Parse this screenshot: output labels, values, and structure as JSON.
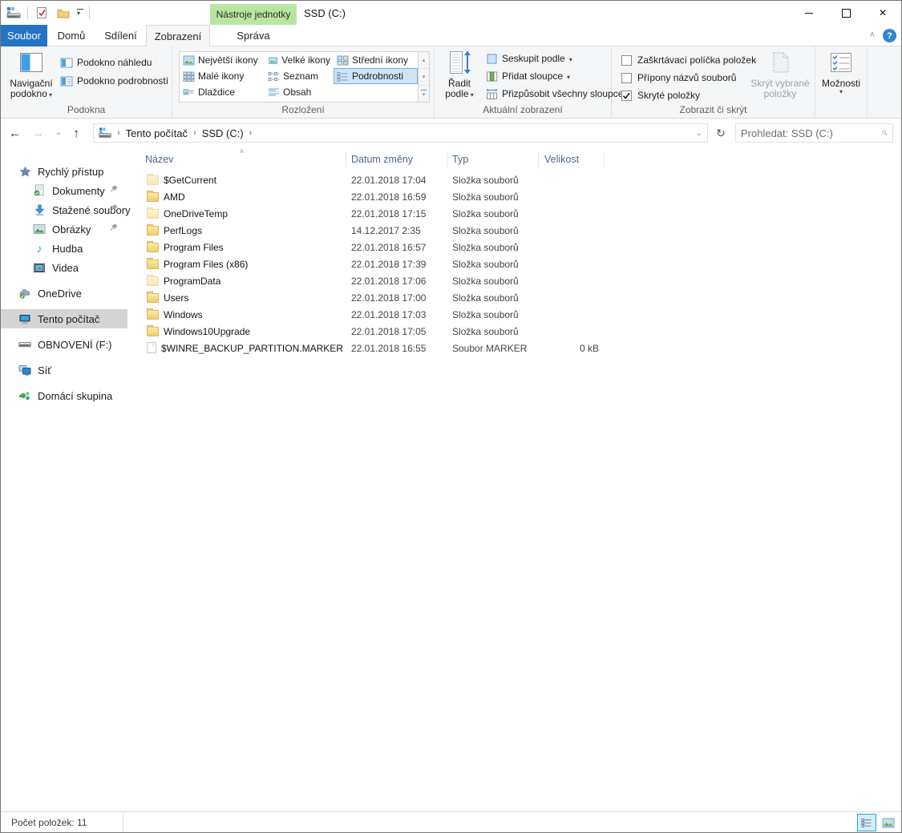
{
  "window": {
    "title": "SSD (C:)",
    "contextual_group": "Nástroje jednotky"
  },
  "tabs": {
    "file": "Soubor",
    "home": "Domů",
    "share": "Sdílení",
    "view": "Zobrazení",
    "manage": "Správa"
  },
  "ribbon": {
    "panes": {
      "label": "Podokna",
      "nav_l1": "Navigační",
      "nav_l2": "podokno",
      "preview": "Podokno náhledu",
      "details": "Podokno podrobností"
    },
    "layout": {
      "label": "Rozložení",
      "items": [
        "Největší ikony",
        "Velké ikony",
        "Střední ikony",
        "Malé ikony",
        "Seznam",
        "Podrobnosti",
        "Dlaždice",
        "Obsah"
      ],
      "selected": "Podrobnosti"
    },
    "view": {
      "label": "Aktuální zobrazení",
      "sort_l1": "Řadit",
      "sort_l2": "podle",
      "group_by": "Seskupit podle",
      "add_columns": "Přidat sloupce",
      "fit_columns": "Přizpůsobit všechny sloupce"
    },
    "showhide": {
      "label": "Zobrazit či skrýt",
      "cb_item_checkboxes": "Zaškrtávací políčka položek",
      "cb_extensions": "Přípony názvů souborů",
      "cb_hidden": "Skryté položky",
      "cb_hidden_checked": true,
      "hide_l1": "Skrýt vybrané",
      "hide_l2": "položky"
    },
    "options": {
      "label": "Možnosti"
    }
  },
  "address": {
    "crumb_root": "Tento počítač",
    "crumb_drive": "SSD (C:)",
    "search_placeholder": "Prohledat: SSD (C:)"
  },
  "sidebar": {
    "quick_access": "Rychlý přístup",
    "documents": "Dokumenty",
    "downloads": "Stažené soubory",
    "pictures": "Obrázky",
    "music": "Hudba",
    "videos": "Videa",
    "onedrive": "OneDrive",
    "this_pc": "Tento počítač",
    "recovery": "OBNOVENÍ (F:)",
    "network": "Síť",
    "homegroup": "Domácí skupina"
  },
  "files": {
    "columns": {
      "name": "Název",
      "date": "Datum změny",
      "type": "Typ",
      "size": "Velikost"
    },
    "rows": [
      {
        "name": "$GetCurrent",
        "date": "22.01.2018 17:04",
        "type": "Složka souborů",
        "size": "",
        "icon": "folder-faded"
      },
      {
        "name": "AMD",
        "date": "22.01.2018 16:59",
        "type": "Složka souborů",
        "size": "",
        "icon": "folder"
      },
      {
        "name": "OneDriveTemp",
        "date": "22.01.2018 17:15",
        "type": "Složka souborů",
        "size": "",
        "icon": "folder-faded"
      },
      {
        "name": "PerfLogs",
        "date": "14.12.2017 2:35",
        "type": "Složka souborů",
        "size": "",
        "icon": "folder"
      },
      {
        "name": "Program Files",
        "date": "22.01.2018 16:57",
        "type": "Složka souborů",
        "size": "",
        "icon": "folder"
      },
      {
        "name": "Program Files (x86)",
        "date": "22.01.2018 17:39",
        "type": "Složka souborů",
        "size": "",
        "icon": "folder"
      },
      {
        "name": "ProgramData",
        "date": "22.01.2018 17:06",
        "type": "Složka souborů",
        "size": "",
        "icon": "folder-faded"
      },
      {
        "name": "Users",
        "date": "22.01.2018 17:00",
        "type": "Složka souborů",
        "size": "",
        "icon": "folder"
      },
      {
        "name": "Windows",
        "date": "22.01.2018 17:03",
        "type": "Složka souborů",
        "size": "",
        "icon": "folder"
      },
      {
        "name": "Windows10Upgrade",
        "date": "22.01.2018 17:05",
        "type": "Složka souborů",
        "size": "",
        "icon": "folder"
      },
      {
        "name": "$WINRE_BACKUP_PARTITION.MARKER",
        "date": "22.01.2018 16:55",
        "type": "Soubor MARKER",
        "size": "0 kB",
        "icon": "file-faded"
      }
    ]
  },
  "statusbar": {
    "count": "Počet položek: 11"
  }
}
